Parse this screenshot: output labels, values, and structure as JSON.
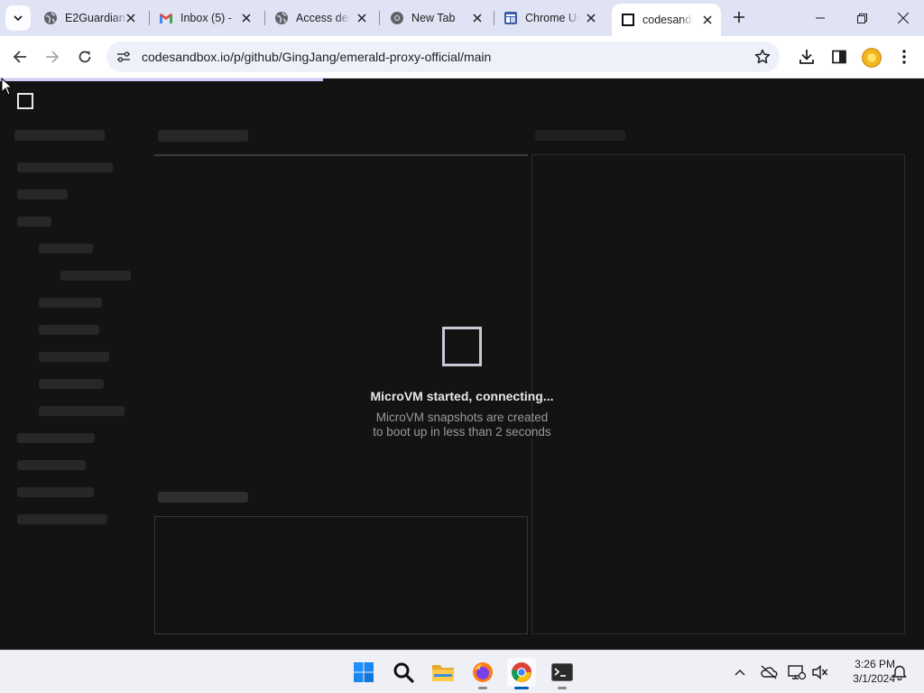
{
  "browser": {
    "tabs": [
      {
        "title": "E2Guardian",
        "favicon": "globe-icon",
        "active": false
      },
      {
        "title": "Inbox (5) - ",
        "favicon": "gmail-icon",
        "active": false
      },
      {
        "title": "Access denied",
        "favicon": "globe-icon",
        "active": false
      },
      {
        "title": "New Tab",
        "favicon": "chrome-icon",
        "active": false
      },
      {
        "title": "Chrome Us",
        "favicon": "app-icon",
        "active": false
      },
      {
        "title": "codesandbox",
        "favicon": "codesandbox-icon",
        "active": true
      }
    ],
    "address_bar": {
      "url": "codesandbox.io/p/github/GingJang/emerald-proxy-official/main"
    }
  },
  "page": {
    "status": {
      "title": "MicroVM started, connecting...",
      "subtitle_line1": "MicroVM snapshots are created",
      "subtitle_line2": "to boot up in less than 2 seconds"
    }
  },
  "taskbar": {
    "apps": [
      "windows-start",
      "search",
      "file-explorer",
      "firefox",
      "chrome",
      "terminal"
    ],
    "clock": {
      "time": "3:26 PM",
      "date": "3/1/2024"
    }
  },
  "colors": {
    "accent": "#d0cdfb",
    "page_bg": "#131313",
    "tabstrip_bg": "#dfe3f3"
  }
}
